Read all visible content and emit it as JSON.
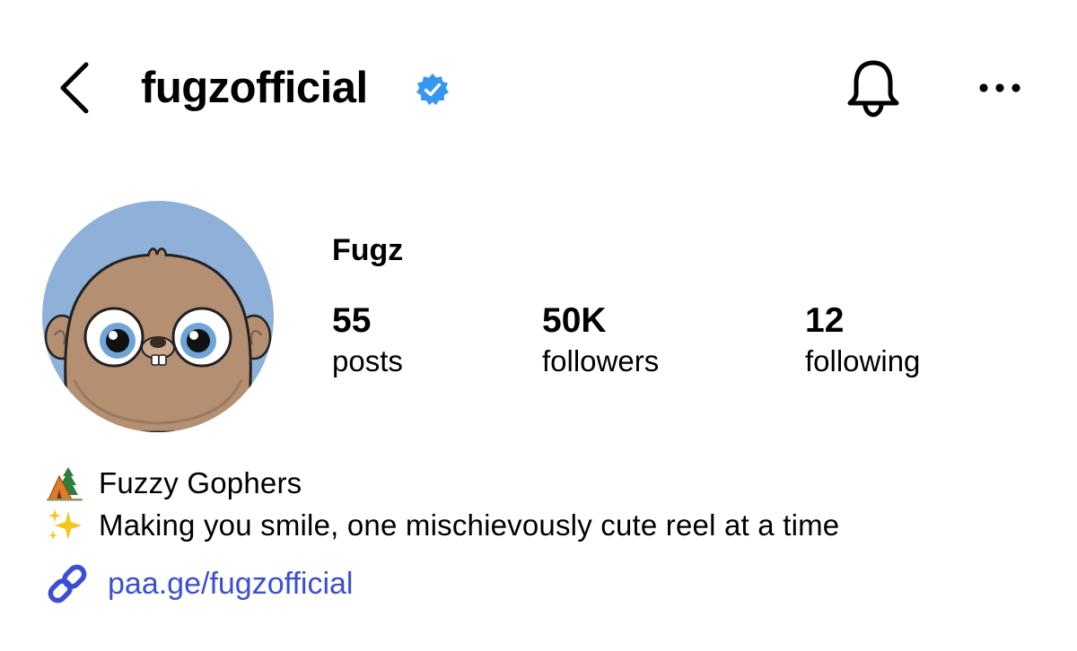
{
  "header": {
    "username": "fugzofficial",
    "verified": true,
    "icons": [
      "back-chevron-icon",
      "verified-badge-icon",
      "bell-icon",
      "more-horizontal-icon"
    ]
  },
  "profile": {
    "display_name": "Fugz",
    "avatar": "gopher-cartoon-avatar",
    "stats": {
      "posts": {
        "value": "55",
        "label": "posts"
      },
      "followers": {
        "value": "50K",
        "label": "followers"
      },
      "following": {
        "value": "12",
        "label": "following"
      }
    }
  },
  "bio": {
    "line1": {
      "emoji": "camping-tent-emoji",
      "text": "Fuzzy Gophers"
    },
    "line2": {
      "emoji": "sparkles-emoji",
      "text": "Making you smile, one mischievously cute reel at a time"
    }
  },
  "link": {
    "icon": "link-icon",
    "text": "paa.ge/fugzofficial"
  },
  "colors": {
    "link": "#3b4fd6",
    "verified": "#3797f0",
    "avatar_bg": "#8fb0d8",
    "gopher_fur": "#b48f72"
  }
}
